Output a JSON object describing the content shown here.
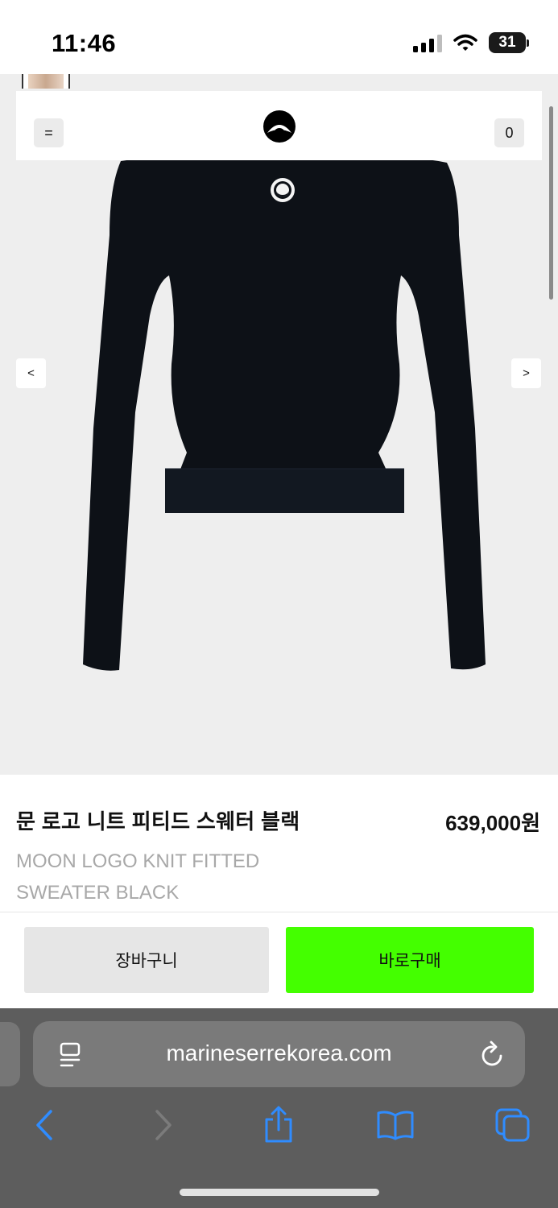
{
  "status_bar": {
    "time": "11:46",
    "battery": "31"
  },
  "header": {
    "menu_label": "=",
    "cart_count": "0"
  },
  "gallery": {
    "prev_label": "<",
    "next_label": ">"
  },
  "product": {
    "name_ko": "문 로고 니트 피티드 스웨터 블랙",
    "price": "639,000원",
    "name_en": "MOON LOGO KNIT FITTED SWEATER BLACK"
  },
  "actions": {
    "cart_label": "장바구니",
    "buy_label": "바로구매"
  },
  "browser": {
    "url": "marineserrekorea.com"
  },
  "colors": {
    "buy_button": "#44ff00",
    "cart_button": "#e6e6e6",
    "gallery_bg": "#eeeeee",
    "toolbar": "#5d5d5d"
  }
}
